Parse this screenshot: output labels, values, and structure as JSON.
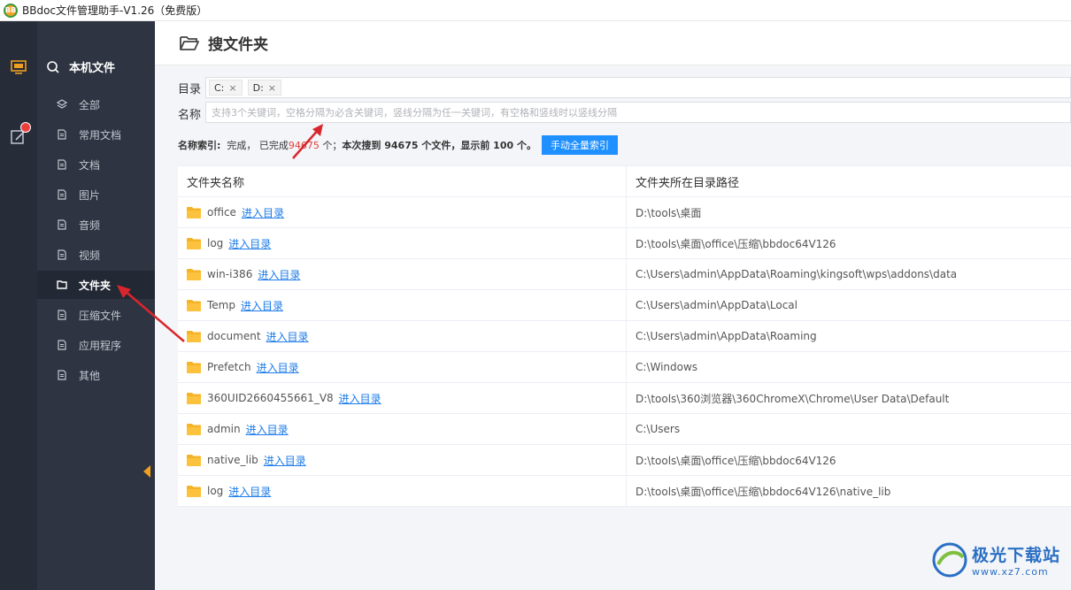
{
  "window": {
    "title": "BBdoc文件管理助手-V1.26（免费版）",
    "logo_text": "BB"
  },
  "rail": {
    "items": [
      {
        "icon": "monitor-icon"
      },
      {
        "icon": "edit-icon",
        "badge": true
      }
    ]
  },
  "sidebar": {
    "header": "本机文件",
    "items": [
      {
        "label": "全部",
        "icon": "layers-icon"
      },
      {
        "label": "常用文档",
        "icon": "doc-icon"
      },
      {
        "label": "文档",
        "icon": "text-doc-icon"
      },
      {
        "label": "图片",
        "icon": "image-icon"
      },
      {
        "label": "音频",
        "icon": "audio-icon"
      },
      {
        "label": "视频",
        "icon": "video-icon"
      },
      {
        "label": "文件夹",
        "icon": "folder-icon",
        "active": true
      },
      {
        "label": "压缩文件",
        "icon": "archive-icon"
      },
      {
        "label": "应用程序",
        "icon": "app-icon"
      },
      {
        "label": "其他",
        "icon": "other-icon"
      }
    ]
  },
  "main": {
    "title": "搜文件夹",
    "dir_label": "目录",
    "dir_tags": [
      "C:",
      "D:"
    ],
    "name_label": "名称",
    "name_placeholder": "支持3个关键词，空格分隔为必含关键词，竖线分隔为任一关键词，有空格和竖线时以竖线分隔",
    "status": {
      "index_label": "名称索引:",
      "index_state": "完成，",
      "done_prefix": "已完成",
      "done_count": "94675",
      "done_suffix": "个；",
      "found_text": "本次搜到 94675 个文件，显示前 100 个。",
      "button": "手动全量索引"
    },
    "table": {
      "headers": [
        "文件夹名称",
        "文件夹所在目录路径"
      ],
      "link_label": "进入目录",
      "rows": [
        {
          "name": "office",
          "path": "D:\\tools\\桌面"
        },
        {
          "name": "log",
          "path": "D:\\tools\\桌面\\office\\压缩\\bbdoc64V126"
        },
        {
          "name": "win-i386",
          "path": "C:\\Users\\admin\\AppData\\Roaming\\kingsoft\\wps\\addons\\data"
        },
        {
          "name": "Temp",
          "path": "C:\\Users\\admin\\AppData\\Local"
        },
        {
          "name": "document",
          "path": "C:\\Users\\admin\\AppData\\Roaming"
        },
        {
          "name": "Prefetch",
          "path": "C:\\Windows"
        },
        {
          "name": "360UID2660455661_V8",
          "path": "D:\\tools\\360浏览器\\360ChromeX\\Chrome\\User Data\\Default"
        },
        {
          "name": "admin",
          "path": "C:\\Users"
        },
        {
          "name": "native_lib",
          "path": "D:\\tools\\桌面\\office\\压缩\\bbdoc64V126"
        },
        {
          "name": "log",
          "path": "D:\\tools\\桌面\\office\\压缩\\bbdoc64V126\\native_lib"
        }
      ]
    }
  },
  "watermark": {
    "line1": "极光下载站",
    "line2": "www.xz7.com"
  },
  "colors": {
    "accent": "#1e90ff",
    "sidebar": "#2e3441",
    "rail": "#262c38",
    "folder": "#f5b327",
    "arrow": "#d9262c"
  }
}
